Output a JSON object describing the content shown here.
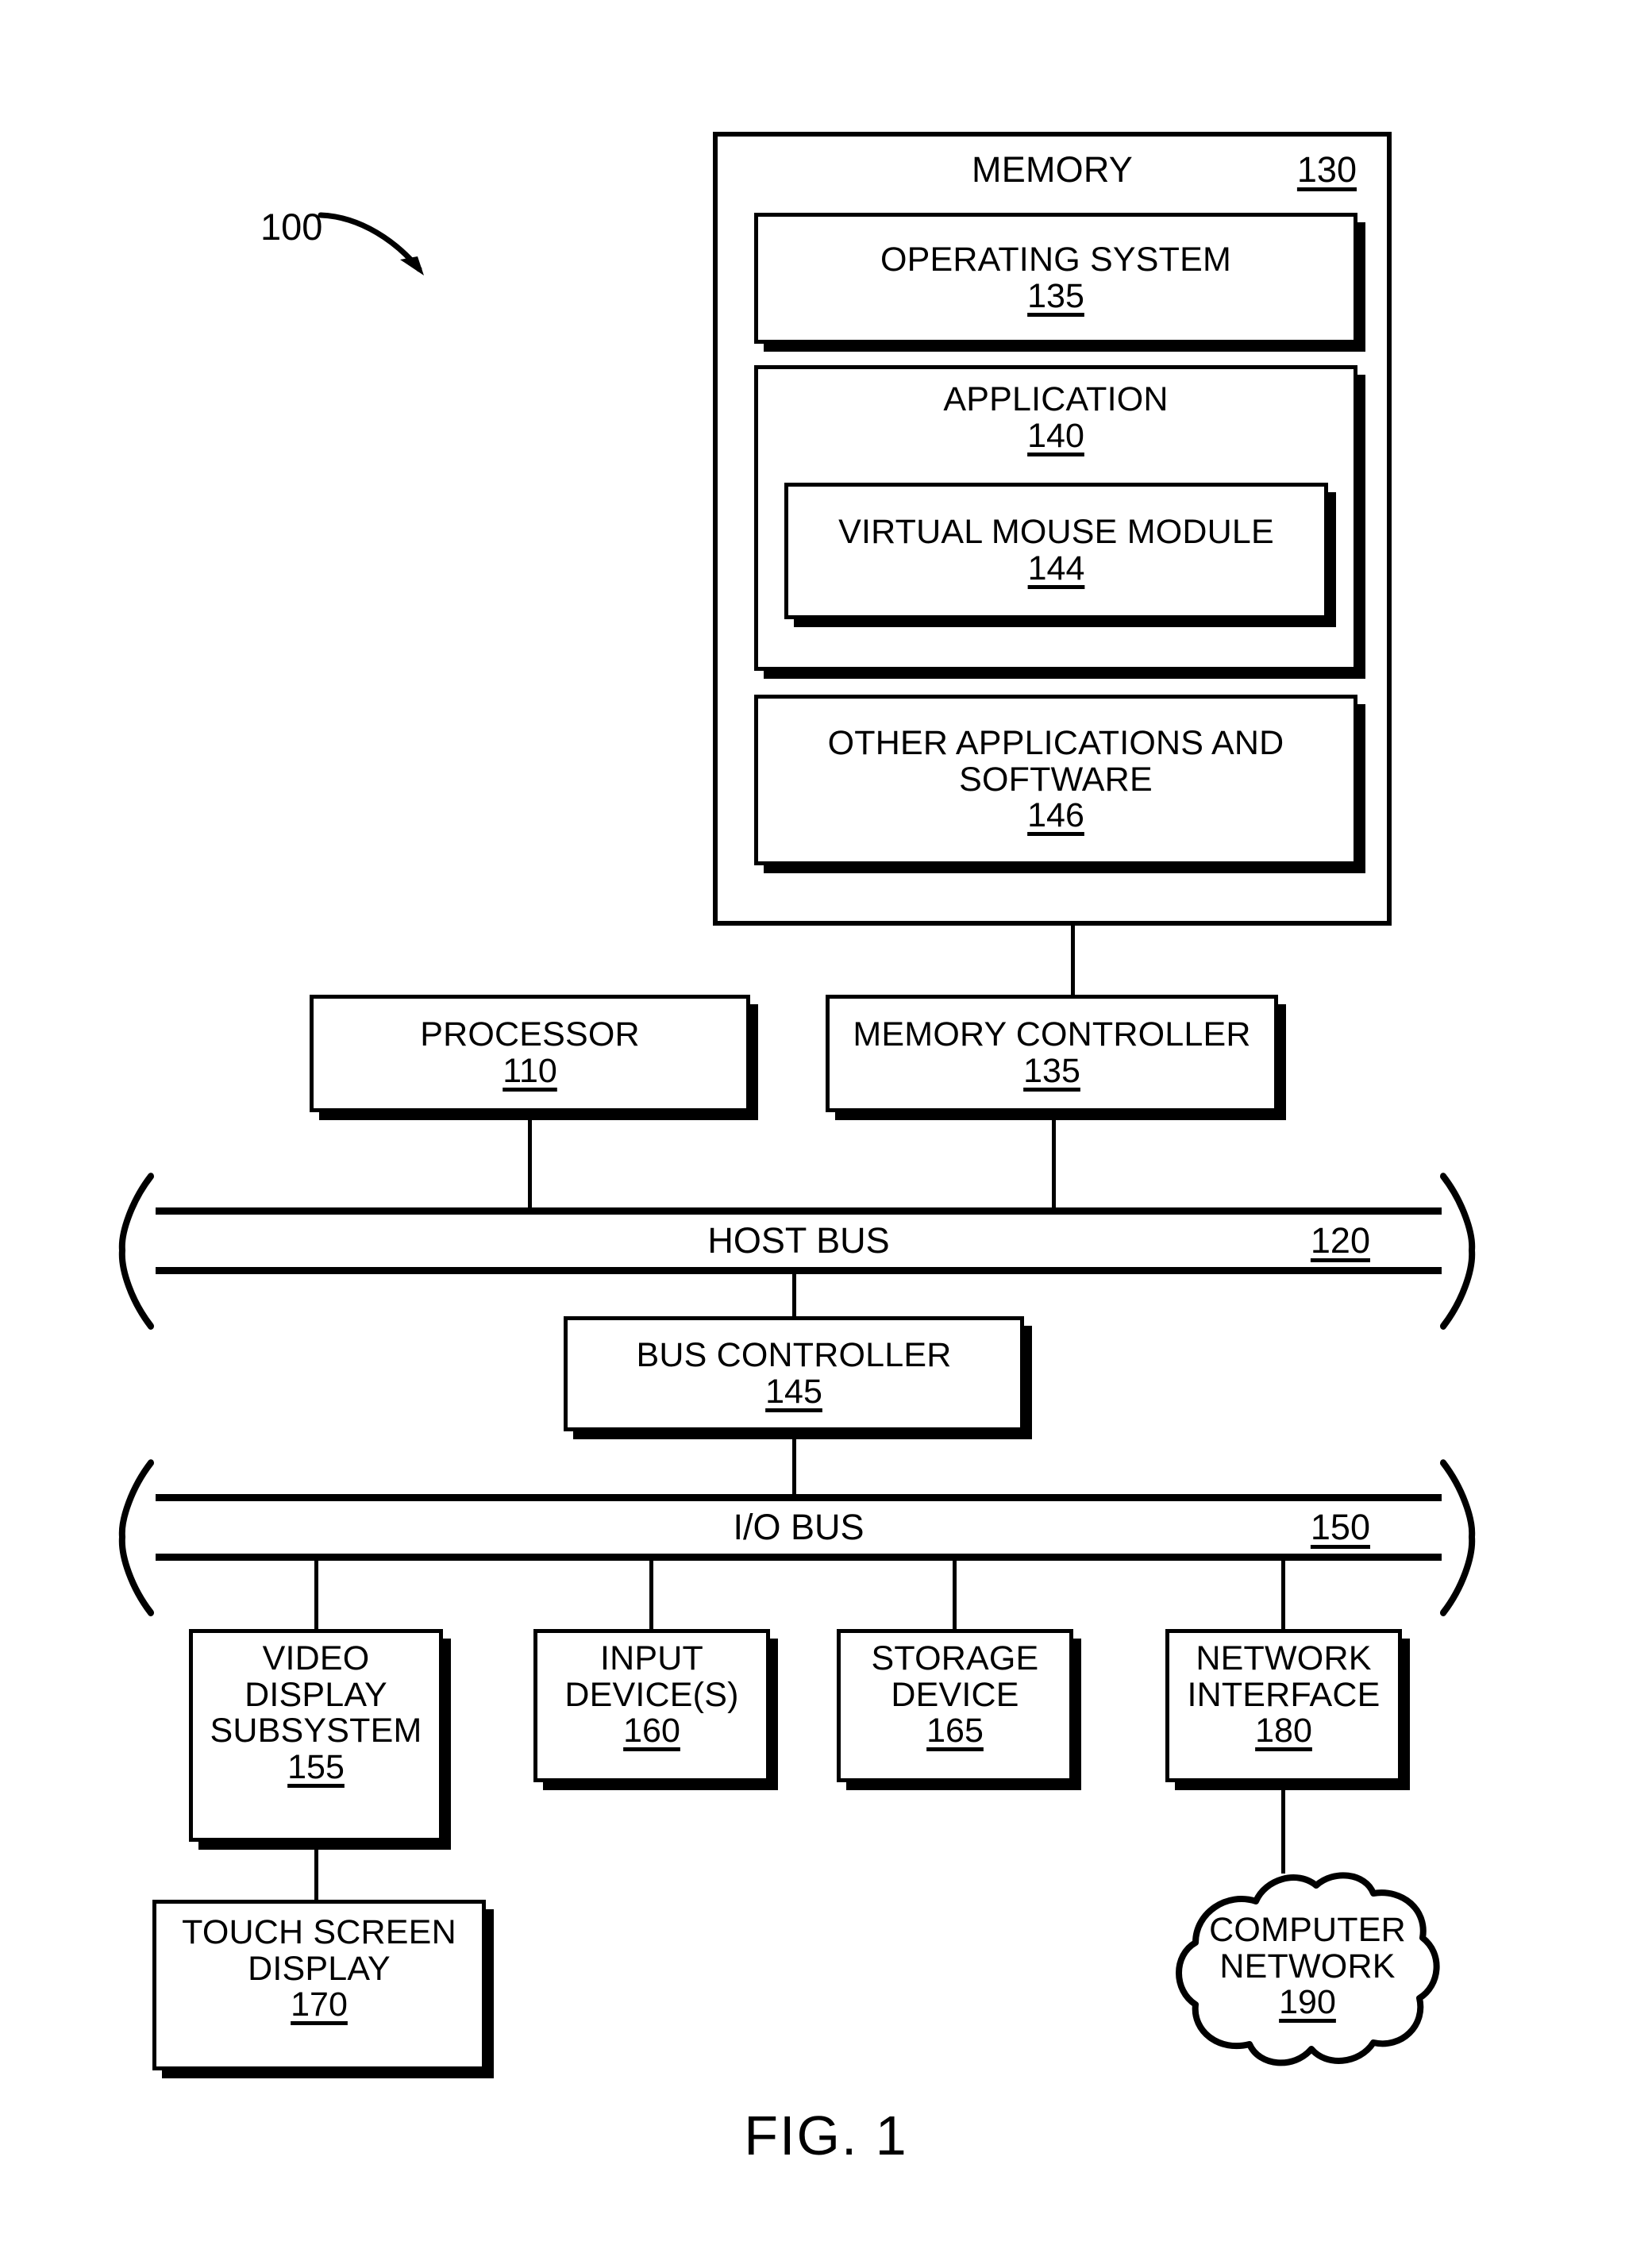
{
  "figure": {
    "caption": "FIG. 1",
    "system_ref": "100"
  },
  "memory": {
    "label": "MEMORY",
    "ref": "130",
    "operating_system": {
      "label": "OPERATING SYSTEM",
      "ref": "135"
    },
    "application": {
      "label": "APPLICATION",
      "ref": "140"
    },
    "virtual_mouse_module": {
      "label": "VIRTUAL MOUSE MODULE",
      "ref": "144"
    },
    "other_applications": {
      "line1": "OTHER APPLICATIONS AND",
      "line2": "SOFTWARE",
      "ref": "146"
    }
  },
  "processor": {
    "label": "PROCESSOR",
    "ref": "110"
  },
  "memory_controller": {
    "label": "MEMORY CONTROLLER",
    "ref": "135"
  },
  "host_bus": {
    "label": "HOST BUS",
    "ref": "120"
  },
  "bus_controller": {
    "label": "BUS CONTROLLER",
    "ref": "145"
  },
  "io_bus": {
    "label": "I/O BUS",
    "ref": "150"
  },
  "video_display_subsystem": {
    "line1": "VIDEO",
    "line2": "DISPLAY",
    "line3": "SUBSYSTEM",
    "ref": "155"
  },
  "input_devices": {
    "line1": "INPUT",
    "line2": "DEVICE(S)",
    "ref": "160"
  },
  "storage_device": {
    "line1": "STORAGE",
    "line2": "DEVICE",
    "ref": "165"
  },
  "network_interface": {
    "line1": "NETWORK",
    "line2": "INTERFACE",
    "ref": "180"
  },
  "touch_screen_display": {
    "line1": "TOUCH SCREEN",
    "line2": "DISPLAY",
    "ref": "170"
  },
  "computer_network": {
    "line1": "COMPUTER",
    "line2": "NETWORK",
    "ref": "190"
  },
  "colors": {
    "ink": "#000000",
    "paper": "#ffffff"
  }
}
